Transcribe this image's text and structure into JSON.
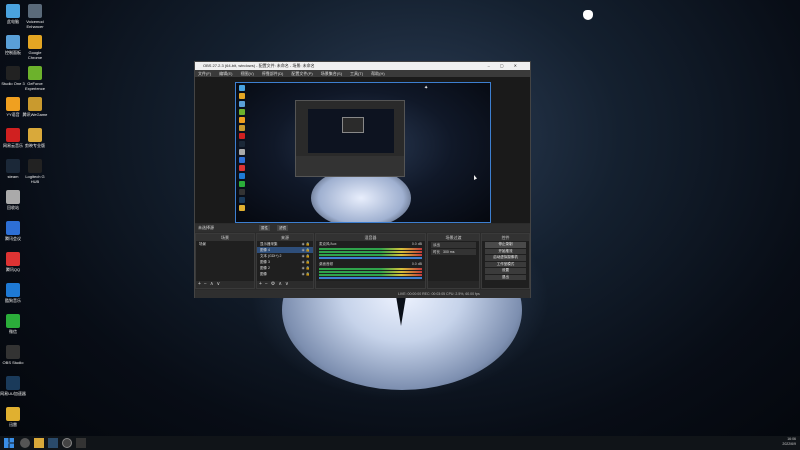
{
  "desktop": {
    "icons": [
      {
        "name": "computer-icon",
        "label": "此电脑",
        "color": "#4aa3df"
      },
      {
        "name": "network-icon",
        "label": "控制面板",
        "color": "#5aa0d8"
      },
      {
        "name": "studio-one-icon",
        "label": "Studio One 3",
        "color": "#222"
      },
      {
        "name": "cloud-music-icon",
        "label": "YY语音",
        "color": "#f0a020"
      },
      {
        "name": "netease-music-icon",
        "label": "网易云音乐",
        "color": "#d02020"
      },
      {
        "name": "steam-icon",
        "label": "steam",
        "color": "#1b2838"
      },
      {
        "name": "recycle-bin-icon",
        "label": "回收站",
        "color": "#aaa"
      },
      {
        "name": "tencent-meeting-icon",
        "label": "腾讯会议",
        "color": "#2d6fd6"
      },
      {
        "name": "qq-music-icon",
        "label": "腾讯QQ",
        "color": "#d33"
      },
      {
        "name": "kugou-icon",
        "label": "酷狗音乐",
        "color": "#1e7ad6"
      },
      {
        "name": "wechat-icon",
        "label": "微信",
        "color": "#2bad3a"
      },
      {
        "name": "obs-icon",
        "label": "OBS Studio",
        "color": "#333"
      },
      {
        "name": "netease-uu-icon",
        "label": "网易UU加速器",
        "color": "#1a3a5a"
      },
      {
        "name": "game-icon",
        "label": "迅雷",
        "color": "#e0b030"
      }
    ],
    "icons_col2": [
      {
        "name": "voicemeeter-icon",
        "label": "Voicemod Enhancer",
        "color": "#5a6a7a"
      },
      {
        "name": "chrome-icon",
        "label": "Google Chrome",
        "color": "#e4a623"
      },
      {
        "name": "geforce-icon",
        "label": "GeForce Experience",
        "color": "#6cb22c"
      },
      {
        "name": "wegame-icon",
        "label": "腾讯WeGame",
        "color": "#c99a2e"
      },
      {
        "name": "theater-icon",
        "label": "剪映专业版",
        "color": "#d9a93a"
      },
      {
        "name": "logitech-icon",
        "label": "Logitech G HUB",
        "color": "#222"
      }
    ]
  },
  "taskbar": {
    "time": "16:06",
    "date": "2022/6/9"
  },
  "obs": {
    "title": "OBS 27.2.3 (64-bit, windows) - 配置文件: 未命名 - 场景: 未命名",
    "menu": [
      "文件(F)",
      "编辑(E)",
      "视图(V)",
      "停靠部件(D)",
      "配置文件(P)",
      "场景集合(S)",
      "工具(T)",
      "帮助(H)"
    ],
    "scene_bar_label": "未选择源",
    "scene_bar_buttons": [
      "属性",
      "滤镜"
    ],
    "docks": {
      "scenes": {
        "title": "场景",
        "items": [
          "场景"
        ]
      },
      "sources": {
        "title": "来源",
        "items": [
          "显示器采集",
          "图像 4",
          "文本 (GDI+) 2",
          "图像 3",
          "图像 2",
          "图像"
        ]
      },
      "mixer": {
        "title": "混音器",
        "channels": [
          {
            "name": "麦克风/Aux",
            "db": "0.0 dB"
          },
          {
            "name": "桌面音频",
            "db": "0.0 dB"
          }
        ]
      },
      "transitions": {
        "title": "场景过渡",
        "type": "淡出",
        "duration_label": "时长",
        "duration": "300 ms"
      },
      "controls": {
        "title": "控件",
        "buttons": [
          "停止录制",
          "开始推流",
          "启动虚拟摄像机",
          "工作室模式",
          "设置",
          "退出"
        ]
      }
    },
    "status": "LIVE: 00:00:00   REC: 00:03:05   CPU: 2.5%, 60.00 fps"
  }
}
